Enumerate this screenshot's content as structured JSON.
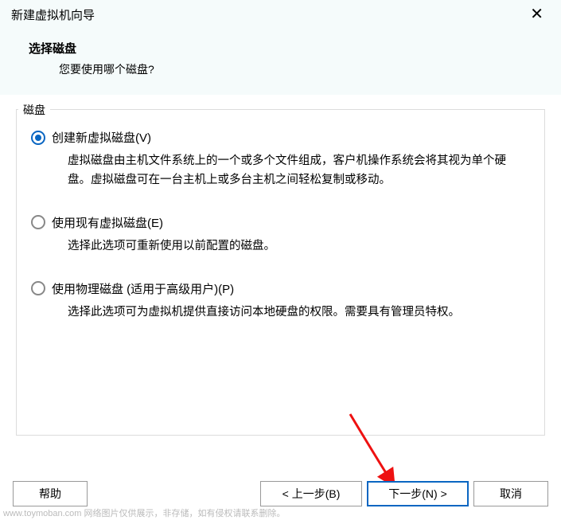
{
  "titlebar": {
    "title": "新建虚拟机向导"
  },
  "header": {
    "heading": "选择磁盘",
    "subheading": "您要使用哪个磁盘?"
  },
  "fieldset": {
    "legend": "磁盘"
  },
  "options": [
    {
      "label": "创建新虚拟磁盘(V)",
      "desc": "虚拟磁盘由主机文件系统上的一个或多个文件组成，客户机操作系统会将其视为单个硬盘。虚拟磁盘可在一台主机上或多台主机之间轻松复制或移动。",
      "selected": true
    },
    {
      "label": "使用现有虚拟磁盘(E)",
      "desc": "选择此选项可重新使用以前配置的磁盘。",
      "selected": false
    },
    {
      "label": "使用物理磁盘 (适用于高级用户)(P)",
      "desc": "选择此选项可为虚拟机提供直接访问本地硬盘的权限。需要具有管理员特权。",
      "selected": false
    }
  ],
  "buttons": {
    "help": "帮助",
    "back": "< 上一步(B)",
    "next": "下一步(N) >",
    "cancel": "取消"
  },
  "watermark": "www.toymoban.com  网络图片仅供展示，非存储，如有侵权请联系删除。"
}
